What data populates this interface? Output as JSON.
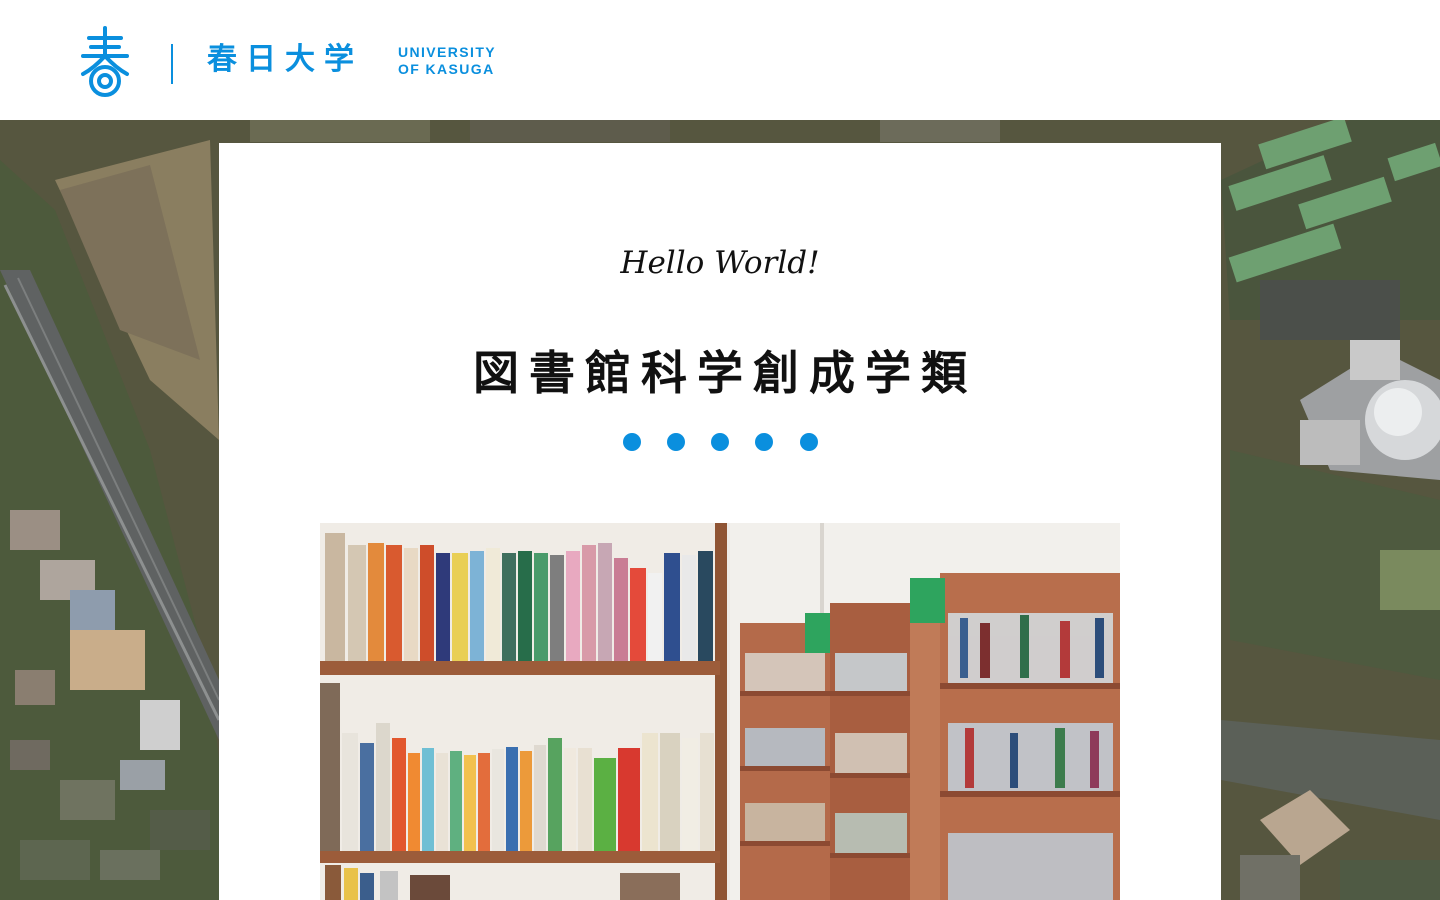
{
  "header": {
    "logo_jp": "春日大学",
    "logo_en_line1": "UNIVERSITY",
    "logo_en_line2": "OF KASUGA"
  },
  "hero": {
    "tagline": "Hello World!",
    "title": "図書館科学創成学類",
    "dots_count": 5
  },
  "colors": {
    "brand_blue": "#0a8fde",
    "text": "#111111"
  },
  "icons": {
    "logo_mark": "kasuga-logo-icon"
  }
}
